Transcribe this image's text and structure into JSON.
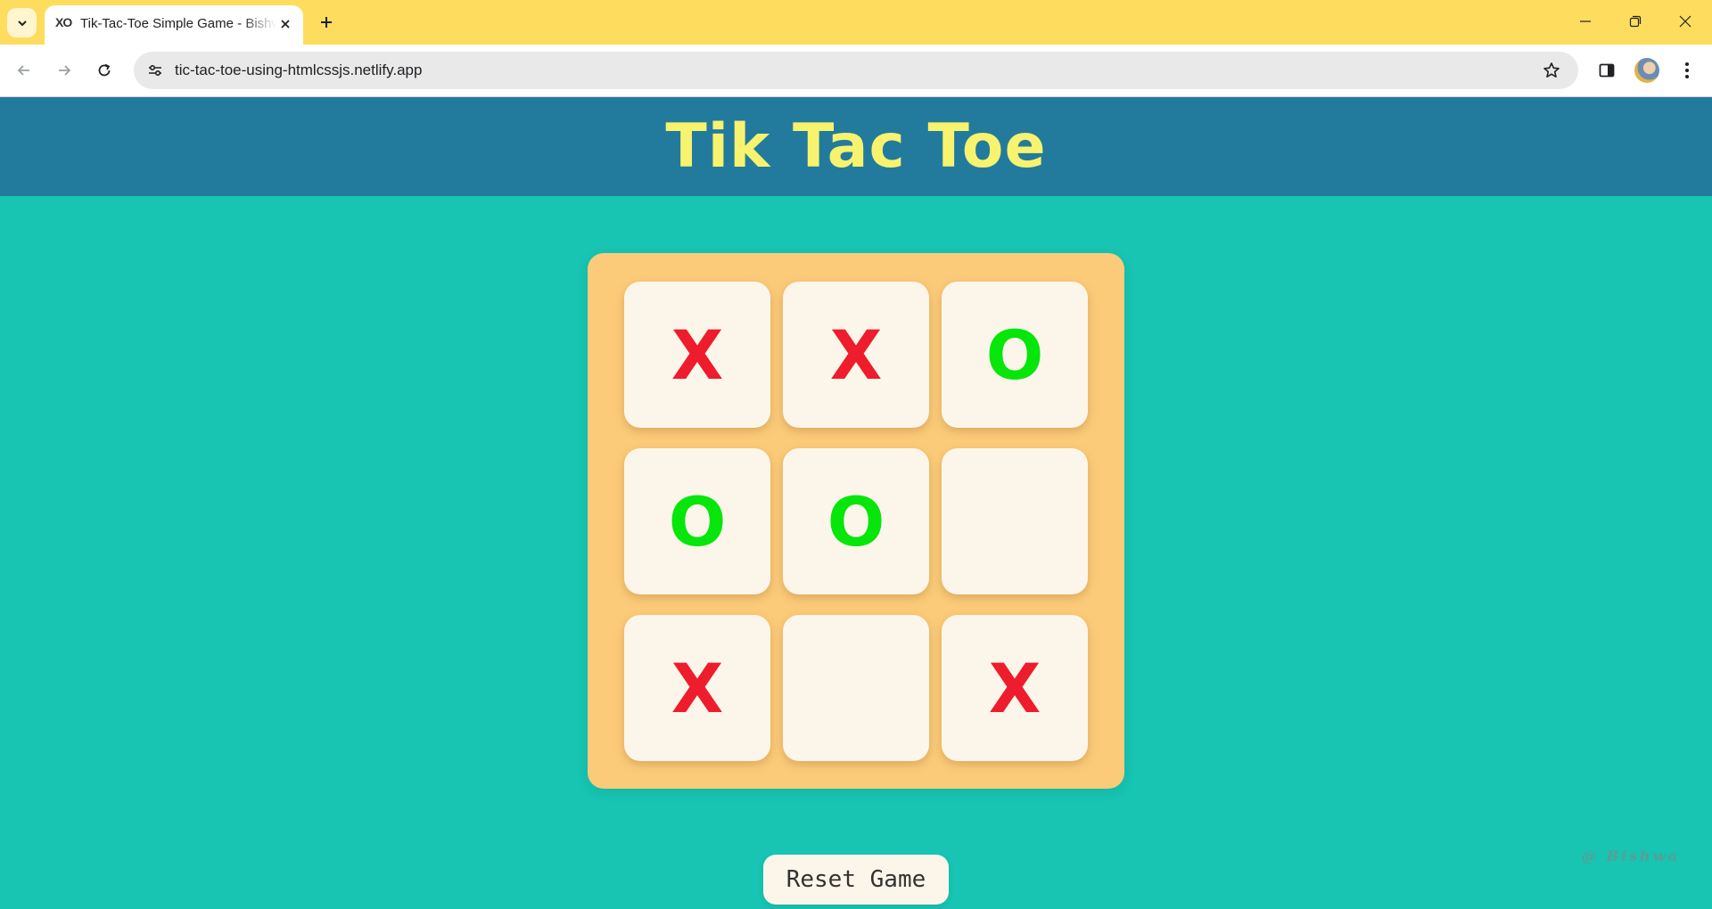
{
  "browser": {
    "tab": {
      "favicon": "XO",
      "title": "Tik-Tac-Toe Simple Game - Bishwa"
    },
    "url": "tic-tac-toe-using-htmlcssjs.netlify.app",
    "theme_color": "#fedc5e"
  },
  "page": {
    "title": "Tik Tac Toe",
    "header_color": "#227b9c",
    "background_color": "#18c4b2",
    "title_color": "#f7f36f"
  },
  "board": {
    "cells": [
      "X",
      "X",
      "O",
      "O",
      "O",
      "",
      "X",
      "",
      "X"
    ],
    "x_color": "#ee1c2c",
    "o_color": "#06e60a"
  },
  "reset_label": "Reset Game",
  "credit": "@ Bishwa"
}
